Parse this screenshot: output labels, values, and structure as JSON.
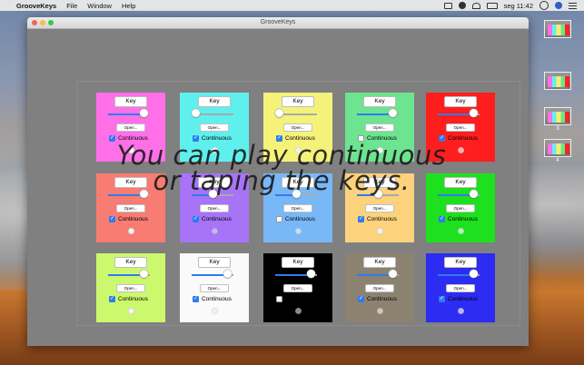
{
  "menubar": {
    "app_name": "GrooveKeys",
    "menus": [
      "File",
      "Window",
      "Help"
    ],
    "clock": "seg 11:42"
  },
  "window": {
    "title": "GrooveKeys"
  },
  "pad_labels": {
    "key": "Key",
    "open": "Open...",
    "continuous": "Continuous"
  },
  "pads": [
    {
      "color": "#ff70e8",
      "slider": 0.85,
      "continuous": true,
      "led": "#f2f2f2",
      "dark": false
    },
    {
      "color": "#5ff0ee",
      "slider": 0.1,
      "continuous": true,
      "led": "#f2f2f2",
      "dark": false
    },
    {
      "color": "#f5f27a",
      "slider": 0.1,
      "continuous": true,
      "led": "#f2f2f2",
      "dark": false
    },
    {
      "color": "#6de490",
      "slider": 0.85,
      "continuous": false,
      "led": "#f2f2f2",
      "dark": false
    },
    {
      "color": "#ff1e1e",
      "slider": 0.85,
      "continuous": true,
      "led": "#ffb0b0",
      "dark": false
    },
    {
      "color": "#f87c72",
      "slider": 0.85,
      "continuous": true,
      "led": "#f2f2f2",
      "dark": false
    },
    {
      "color": "#a774f7",
      "slider": 0.5,
      "continuous": true,
      "led": "#c8b6f7",
      "dark": false
    },
    {
      "color": "#78b8f7",
      "slider": 0.5,
      "continuous": false,
      "led": "#c7dcf5",
      "dark": false
    },
    {
      "color": "#fdd27c",
      "slider": 0.5,
      "continuous": true,
      "led": "#f2f2f2",
      "dark": false
    },
    {
      "color": "#1ee01e",
      "slider": 0.85,
      "continuous": true,
      "led": "#b8f2b8",
      "dark": false
    },
    {
      "color": "#ccf86e",
      "slider": 0.85,
      "continuous": true,
      "led": "#f2f2f2",
      "dark": false
    },
    {
      "color": "#fafafa",
      "slider": 0.85,
      "continuous": true,
      "led": "#f2f2f2",
      "dark": false
    },
    {
      "color": "#000000",
      "slider": 0.85,
      "continuous": false,
      "led": "#8a8a8a",
      "dark": true
    },
    {
      "color": "#8c8270",
      "slider": 0.85,
      "continuous": true,
      "led": "#cfcabf",
      "dark": false
    },
    {
      "color": "#2c2cf2",
      "slider": 0.85,
      "continuous": true,
      "led": "#b5b5f7",
      "dark": false
    }
  ],
  "overlay": {
    "line1": "You can play continuous",
    "line2": "or taping the keys."
  },
  "spaces": {
    "labels": [
      "",
      "",
      "3",
      "4"
    ]
  }
}
